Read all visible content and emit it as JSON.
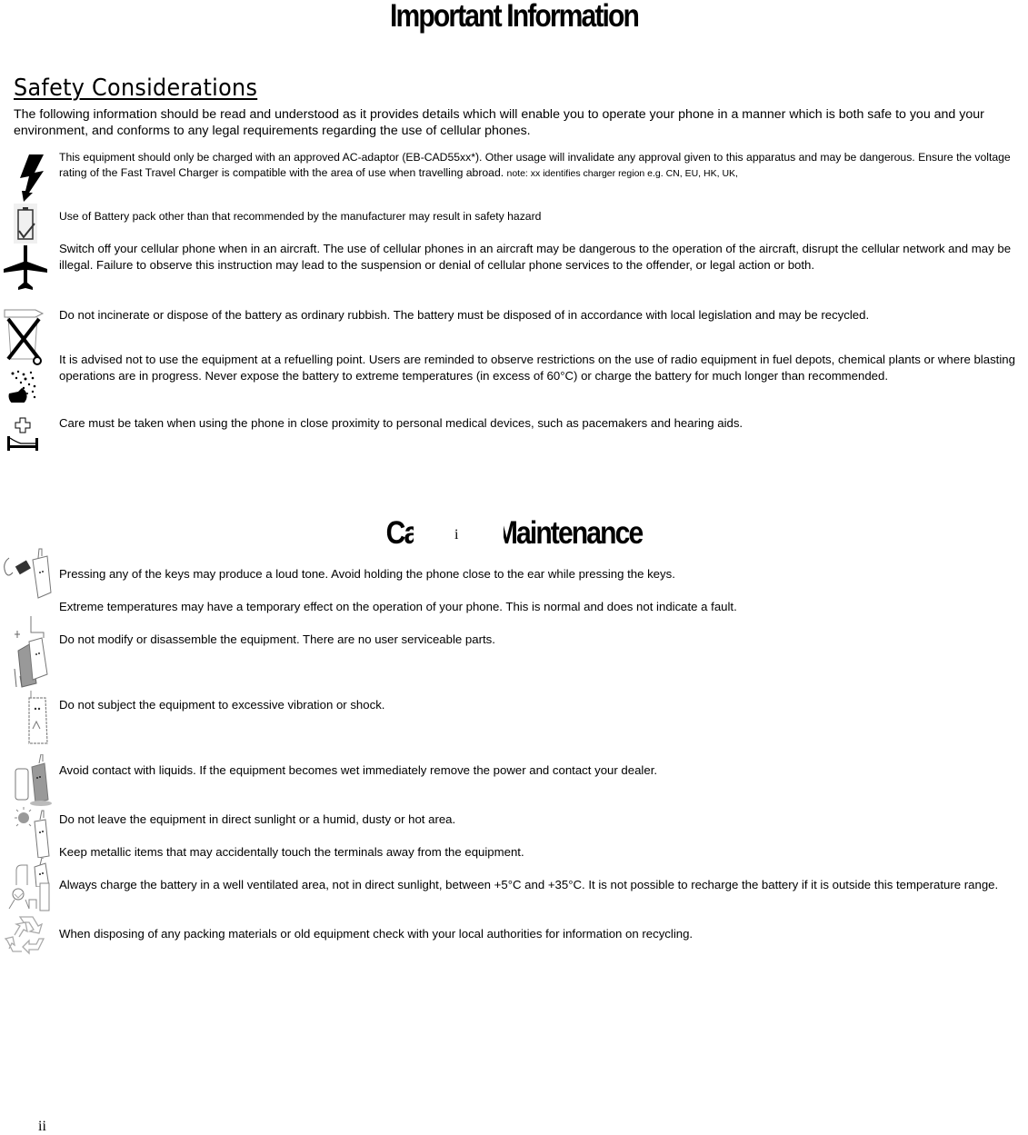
{
  "page": {
    "title": "Important Information",
    "page_number": "ii",
    "overlay_mark": "i"
  },
  "safety": {
    "heading": "Safety Considerations",
    "intro": "The following information should be read and understood as it provides details which will enable you to operate your phone in a manner which is both safe to you and your environment, and conforms to any legal requirements regarding the use of cellular phones.",
    "items": [
      {
        "icon": "lightning-icon",
        "text": "This equipment should only be charged with an approved AC-adaptor (EB-CAD55xx*). Other usage will invalidate any approval given to this apparatus and may be dangerous. Ensure the voltage rating of the Fast Travel Charger is compatible with the area of use when travelling abroad. ",
        "note": "note: xx identifies charger region e.g. CN, EU, HK, UK,"
      },
      {
        "icon": "battery-check-icon",
        "text": "Use of Battery pack other than that recommended by the manufacturer may result in safety hazard"
      },
      {
        "icon": "airplane-icon",
        "text": "Switch off your cellular phone when in an aircraft. The use of cellular phones in an aircraft may be dangerous to the operation of the aircraft, disrupt the cellular network and may be illegal. Failure to observe this instruction may lead to the suspension or denial of cellular phone services to the offender, or legal action or both."
      },
      {
        "icon": "crossed-bin-icon",
        "text": "Do not incinerate or dispose of the battery as ordinary rubbish. The battery must be disposed of in accordance with local legislation and may be recycled."
      },
      {
        "icon": "explosion-icon",
        "text": "It is advised not to use the equipment at a refuelling point. Users are reminded to observe restrictions on the use of radio equipment in fuel depots, chemical plants or where blasting operations are in progress. Never expose the battery to extreme temperatures (in excess of 60°C) or charge the battery for much longer than recommended."
      },
      {
        "icon": "hospital-bed-icon",
        "text": "Care must be taken when using the phone in close proximity to personal medical devices, such as pacemakers and hearing aids."
      }
    ]
  },
  "care": {
    "heading_left": "Car",
    "heading_right": "d Maintenance",
    "heading_full": "Care and Maintenance",
    "items": [
      {
        "icon": "phone-ear-icon",
        "text": "Pressing any of the keys may produce a loud tone. Avoid holding the phone close to the ear while pressing the keys."
      },
      {
        "icon": "thermometer-phone-icon",
        "text": "Extreme temperatures may have a temporary effect on the operation of your phone. This is normal and does not indicate a fault."
      },
      {
        "icon": "disassemble-phone-icon",
        "text": "Do not modify or disassemble the equipment. There are no user serviceable parts."
      },
      {
        "icon": "shaking-phone-icon",
        "text": "Do not subject the equipment to excessive vibration or shock."
      },
      {
        "icon": "wet-phone-icon",
        "text": "Avoid contact with liquids. If the equipment becomes wet immediately remove the power and contact your dealer."
      },
      {
        "icon": "sun-phone-icon",
        "text": "Do not leave the equipment in direct sunlight or a humid, dusty or hot area."
      },
      {
        "icon": "metal-items-phone-icon",
        "text": "Keep metallic items that may accidentally touch the terminals away from the equipment."
      },
      {
        "icon": "charging-phone-icon",
        "text": "Always charge the battery in a well ventilated area, not in direct sunlight, between +5°C and +35°C. It is not possible to recharge the battery if it is outside this temperature range."
      },
      {
        "icon": "recycle-icon",
        "text": "When disposing of any packing materials or old equipment check with your local authorities for information on recycling."
      }
    ]
  }
}
